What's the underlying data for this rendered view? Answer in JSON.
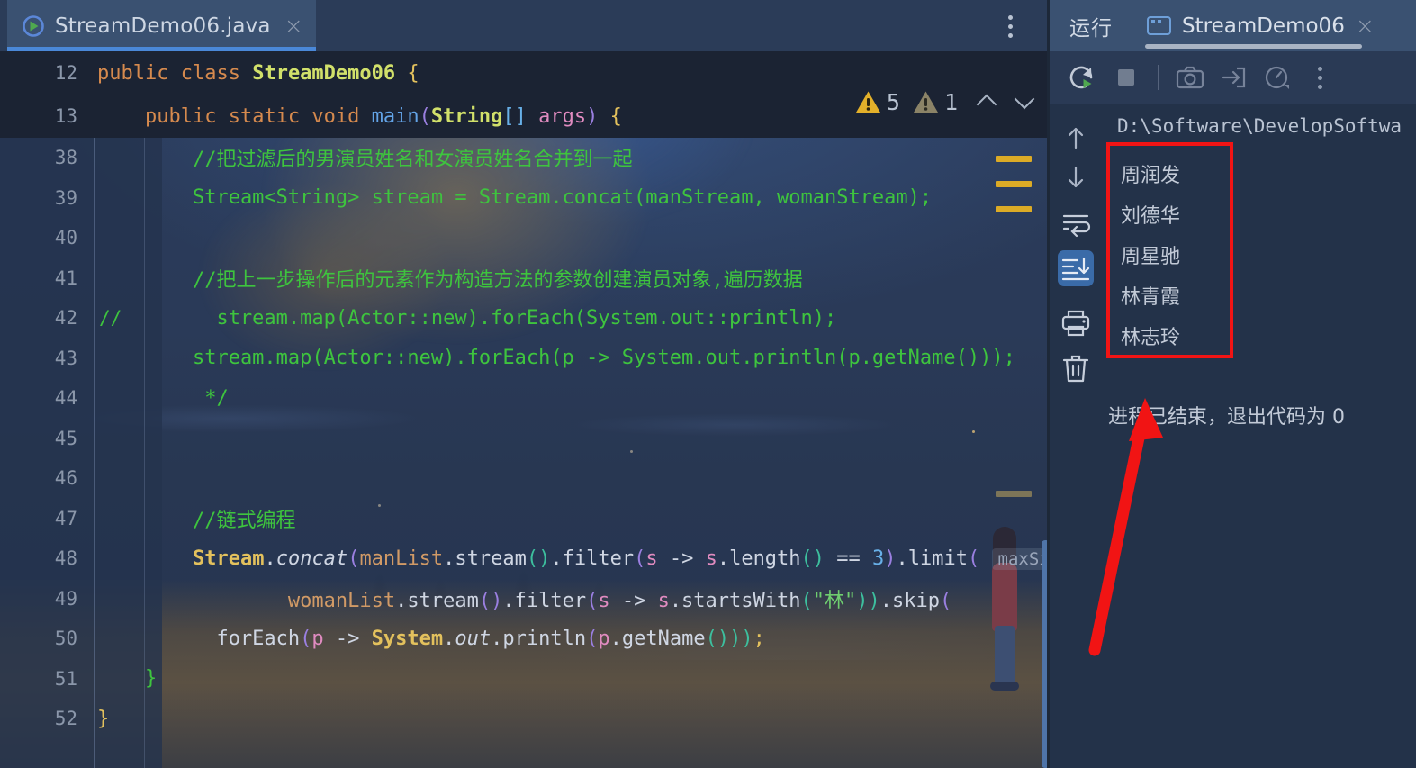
{
  "editor": {
    "tab": {
      "label": "StreamDemo06.java",
      "close": "×",
      "icon": "java-class-icon"
    },
    "more_menu": "tab-overflow-menu",
    "inspections": {
      "warning_count": "5",
      "weak_warning_count": "1",
      "prev": "∧",
      "next": "∨"
    },
    "sticky_lines": [
      {
        "num": "12",
        "tokens": [
          {
            "t": "public ",
            "c": "k"
          },
          {
            "t": "class ",
            "c": "k"
          },
          {
            "t": "StreamDemo06",
            "c": "cn"
          },
          {
            "t": " {",
            "c": "yl"
          }
        ]
      },
      {
        "num": "13",
        "tokens": [
          {
            "t": "    ",
            "c": "pl"
          },
          {
            "t": "public ",
            "c": "k"
          },
          {
            "t": "static ",
            "c": "k"
          },
          {
            "t": "void ",
            "c": "k"
          },
          {
            "t": "main",
            "c": "fn"
          },
          {
            "t": "(",
            "c": "bp"
          },
          {
            "t": "String",
            "c": "ty"
          },
          {
            "t": "[] ",
            "c": "num"
          },
          {
            "t": "args",
            "c": "pm"
          },
          {
            "t": ")",
            "c": "bp"
          },
          {
            "t": " {",
            "c": "yl"
          }
        ]
      }
    ],
    "lines": [
      {
        "num": "38",
        "fold": "",
        "tokens": [
          {
            "t": "        //把过滤后的男演员姓名和女演员姓名合并到一起",
            "c": "cm"
          }
        ]
      },
      {
        "num": "39",
        "fold": "",
        "tokens": [
          {
            "t": "        Stream<String> stream = Stream.concat(manStream, womanStream);",
            "c": "cm"
          }
        ]
      },
      {
        "num": "40",
        "fold": "",
        "tokens": []
      },
      {
        "num": "41",
        "fold": "",
        "tokens": [
          {
            "t": "        //把上一步操作后的元素作为构造方法的参数创建演员对象,遍历数据",
            "c": "cm"
          }
        ]
      },
      {
        "num": "42",
        "fold": "//",
        "tokens": [
          {
            "t": "          stream.map(Actor::new).forEach(System.out::println);",
            "c": "cm"
          }
        ]
      },
      {
        "num": "43",
        "fold": "",
        "tokens": [
          {
            "t": "        stream.map(Actor::new).forEach(p -> System.out.println(p.getName()));",
            "c": "cm"
          }
        ]
      },
      {
        "num": "44",
        "fold": "",
        "tokens": [
          {
            "t": "         */",
            "c": "cm"
          }
        ]
      },
      {
        "num": "45",
        "fold": "",
        "tokens": []
      },
      {
        "num": "46",
        "fold": "",
        "tokens": []
      },
      {
        "num": "47",
        "fold": "",
        "tokens": [
          {
            "t": "        //链式编程",
            "c": "cm"
          }
        ]
      },
      {
        "num": "48",
        "fold": "",
        "tokens": [
          {
            "t": "        ",
            "c": "pl"
          },
          {
            "t": "Stream",
            "c": "fy"
          },
          {
            "t": ".",
            "c": "pl"
          },
          {
            "t": "concat",
            "c": "pl it"
          },
          {
            "t": "(",
            "c": "bp"
          },
          {
            "t": "manList",
            "c": "orf"
          },
          {
            "t": ".stream",
            "c": "pl"
          },
          {
            "t": "()",
            "c": "br"
          },
          {
            "t": ".filter",
            "c": "pl"
          },
          {
            "t": "(",
            "c": "bp"
          },
          {
            "t": "s",
            "c": "pm"
          },
          {
            "t": " -> ",
            "c": "pl"
          },
          {
            "t": "s",
            "c": "pm"
          },
          {
            "t": ".length",
            "c": "pl"
          },
          {
            "t": "()",
            "c": "br"
          },
          {
            "t": " == ",
            "c": "pl"
          },
          {
            "t": "3",
            "c": "num"
          },
          {
            "t": ")",
            "c": "bp"
          },
          {
            "t": ".limit",
            "c": "pl"
          },
          {
            "t": "( ",
            "c": "bp"
          }
        ],
        "hint": "maxSize"
      },
      {
        "num": "49",
        "fold": "",
        "tokens": [
          {
            "t": "                ",
            "c": "pl"
          },
          {
            "t": "womanList",
            "c": "orf"
          },
          {
            "t": ".stream",
            "c": "pl"
          },
          {
            "t": "()",
            "c": "bp"
          },
          {
            "t": ".filter",
            "c": "pl"
          },
          {
            "t": "(",
            "c": "bp"
          },
          {
            "t": "s",
            "c": "pm"
          },
          {
            "t": " -> ",
            "c": "pl"
          },
          {
            "t": "s",
            "c": "pm"
          },
          {
            "t": ".startsWith",
            "c": "pl"
          },
          {
            "t": "(",
            "c": "br"
          },
          {
            "t": "\"林\"",
            "c": "st"
          },
          {
            "t": "))",
            "c": "br"
          },
          {
            "t": ".skip",
            "c": "pl"
          },
          {
            "t": "(",
            "c": "bp"
          }
        ]
      },
      {
        "num": "50",
        "fold": "",
        "tokens": [
          {
            "t": "          forEach",
            "c": "pl"
          },
          {
            "t": "(",
            "c": "bp"
          },
          {
            "t": "p",
            "c": "pm"
          },
          {
            "t": " -> ",
            "c": "pl"
          },
          {
            "t": "System",
            "c": "fy"
          },
          {
            "t": ".",
            "c": "pl"
          },
          {
            "t": "out",
            "c": "pl it"
          },
          {
            "t": ".println",
            "c": "pl"
          },
          {
            "t": "(",
            "c": "bp"
          },
          {
            "t": "p",
            "c": "pm"
          },
          {
            "t": ".getName",
            "c": "pl"
          },
          {
            "t": "()))",
            "c": "br"
          },
          {
            "t": ";",
            "c": "yl"
          }
        ]
      },
      {
        "num": "51",
        "fold": "",
        "tokens": [
          {
            "t": "    }",
            "c": "cm"
          }
        ]
      },
      {
        "num": "52",
        "fold": "",
        "tokens": [
          {
            "t": "}",
            "c": "yl"
          }
        ]
      }
    ],
    "markers": [
      {
        "kind": "warn",
        "top": "20"
      },
      {
        "kind": "warn",
        "top": "48"
      },
      {
        "kind": "warn",
        "top": "76"
      },
      {
        "kind": "weak",
        "top": "392"
      }
    ]
  },
  "run_window": {
    "title": "运行",
    "tab": {
      "label": "StreamDemo06",
      "close": "×",
      "icon": "console-icon"
    },
    "toolbar": [
      {
        "name": "rerun-button",
        "icon": "rerun-icon"
      },
      {
        "name": "stop-button",
        "icon": "stop-icon"
      },
      {
        "name": "screenshot-button",
        "icon": "camera-icon"
      },
      {
        "name": "export-button",
        "icon": "export-icon"
      },
      {
        "name": "profiler-button",
        "icon": "gauge-icon"
      },
      {
        "name": "more-options-button",
        "icon": "more-vertical-icon"
      }
    ],
    "sidebar": [
      {
        "name": "scroll-up-button",
        "icon": "arrow-up-icon",
        "selected": false
      },
      {
        "name": "scroll-down-button",
        "icon": "arrow-down-icon",
        "selected": false
      },
      {
        "name": "soft-wrap-button",
        "icon": "soft-wrap-icon",
        "selected": false
      },
      {
        "name": "scroll-to-end-button",
        "icon": "scroll-to-end-icon",
        "selected": true
      },
      {
        "name": "print-button",
        "icon": "printer-icon",
        "selected": false
      },
      {
        "name": "clear-all-button",
        "icon": "trash-icon",
        "selected": false
      }
    ],
    "console": {
      "command_path": "D:\\Software\\DevelopSoftwa",
      "output": [
        "周润发",
        "刘德华",
        "周星驰",
        "林青霞",
        "林志玲"
      ],
      "exit_message": "进程已结束，退出代码为 0"
    }
  },
  "annotations": {
    "highlight_box_color": "#f11414",
    "arrow_color": "#f11414"
  }
}
